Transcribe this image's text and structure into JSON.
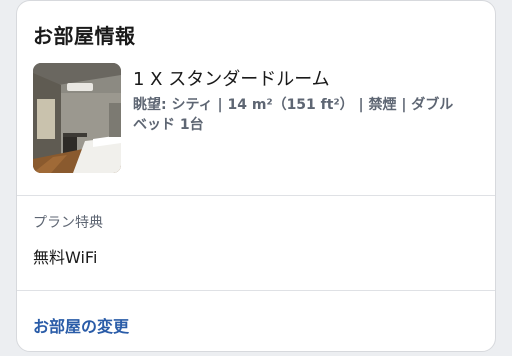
{
  "section": {
    "title": "お部屋情報"
  },
  "room": {
    "name": "1 X スタンダードルーム",
    "details": "眺望: シティ | 14 m²（151 ft²） | 禁煙 | ダブルベッド 1台",
    "photo_icon": "room-photo"
  },
  "plan_perks": {
    "label": "プラン特典",
    "value": "無料WiFi"
  },
  "actions": {
    "change_room_label": "お部屋の変更"
  },
  "colors": {
    "link": "#2a5ca8",
    "secondary_text": "#5e6673",
    "divider": "#dfe1e5"
  }
}
